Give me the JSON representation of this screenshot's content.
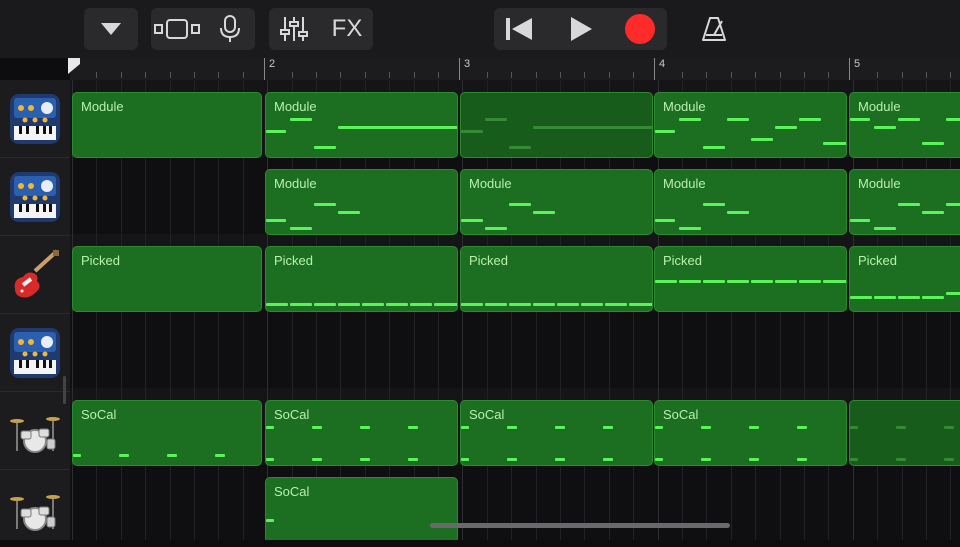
{
  "toolbar": {
    "fx_label": "FX",
    "icons": [
      "dropdown-icon",
      "browser-view-icon",
      "microphone-icon",
      "mixer-icon",
      "rewind-icon",
      "play-icon",
      "record-icon",
      "metronome-icon"
    ],
    "record_color": "#ff2a2a"
  },
  "ruler": {
    "bars": [
      "2",
      "3",
      "4",
      "5"
    ]
  },
  "tracks": [
    {
      "instrument": "synth-keyboard"
    },
    {
      "instrument": "synth-keyboard"
    },
    {
      "instrument": "electric-guitar"
    },
    {
      "instrument": "synth-keyboard"
    },
    {
      "instrument": "drum-kit"
    },
    {
      "instrument": "drum-kit"
    }
  ],
  "regions": [
    {
      "track": 0,
      "bar": 1,
      "label": "Module"
    },
    {
      "track": 0,
      "bar": 2,
      "label": "Module"
    },
    {
      "track": 0,
      "bar": 3,
      "label": ""
    },
    {
      "track": 0,
      "bar": 4,
      "label": "Module"
    },
    {
      "track": 0,
      "bar": 5,
      "label": "Module"
    },
    {
      "track": 1,
      "bar": 2,
      "label": "Module"
    },
    {
      "track": 1,
      "bar": 3,
      "label": "Module"
    },
    {
      "track": 1,
      "bar": 4,
      "label": "Module"
    },
    {
      "track": 1,
      "bar": 5,
      "label": "Module"
    },
    {
      "track": 2,
      "bar": 1,
      "label": "Picked"
    },
    {
      "track": 2,
      "bar": 2,
      "label": "Picked"
    },
    {
      "track": 2,
      "bar": 3,
      "label": "Picked"
    },
    {
      "track": 2,
      "bar": 4,
      "label": "Picked"
    },
    {
      "track": 2,
      "bar": 5,
      "label": "Picked"
    },
    {
      "track": 4,
      "bar": 1,
      "label": "SoCal"
    },
    {
      "track": 4,
      "bar": 2,
      "label": "SoCal"
    },
    {
      "track": 4,
      "bar": 3,
      "label": "SoCal"
    },
    {
      "track": 4,
      "bar": 4,
      "label": "SoCal"
    },
    {
      "track": 4,
      "bar": 5,
      "label": ""
    },
    {
      "track": 5,
      "bar": 2,
      "label": "SoCal"
    }
  ],
  "colors": {
    "region": "#1c6e20",
    "note": "#5cf25c",
    "label": "#b8f0b0"
  }
}
